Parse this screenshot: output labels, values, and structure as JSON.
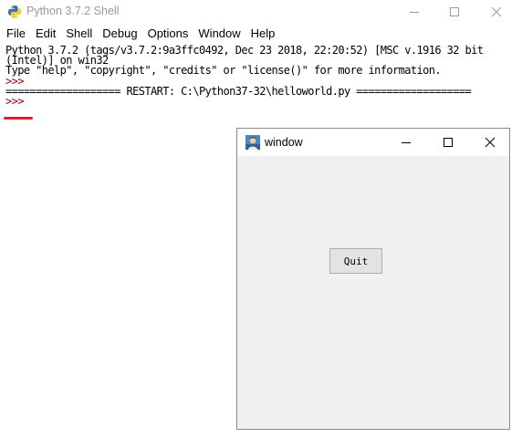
{
  "shell": {
    "title": "Python 3.7.2 Shell",
    "menu": [
      "File",
      "Edit",
      "Shell",
      "Debug",
      "Options",
      "Window",
      "Help"
    ],
    "console_lines": [
      "Python 3.7.2 (tags/v3.7.2:9a3ffc0492, Dec 23 2018, 22:20:52) [MSC v.1916 32 bit",
      "(Intel)] on win32",
      "Type \"help\", \"copyright\", \"credits\" or \"license()\" for more information.",
      ">>> ",
      "=================== RESTART: C:\\Python37-32\\helloworld.py ===================",
      ">>> "
    ],
    "icons": [
      "python-app-icon",
      "minimize-icon",
      "maximize-icon",
      "close-icon"
    ]
  },
  "tk_window": {
    "title": "window",
    "quit_label": "Quit",
    "icons": [
      "tk-app-icon",
      "minimize-icon",
      "maximize-icon",
      "close-icon"
    ]
  },
  "colors": {
    "prompt_underline": "#e0202a",
    "title_gray": "#9a9a9a",
    "tk_background": "#f0f0f0"
  }
}
